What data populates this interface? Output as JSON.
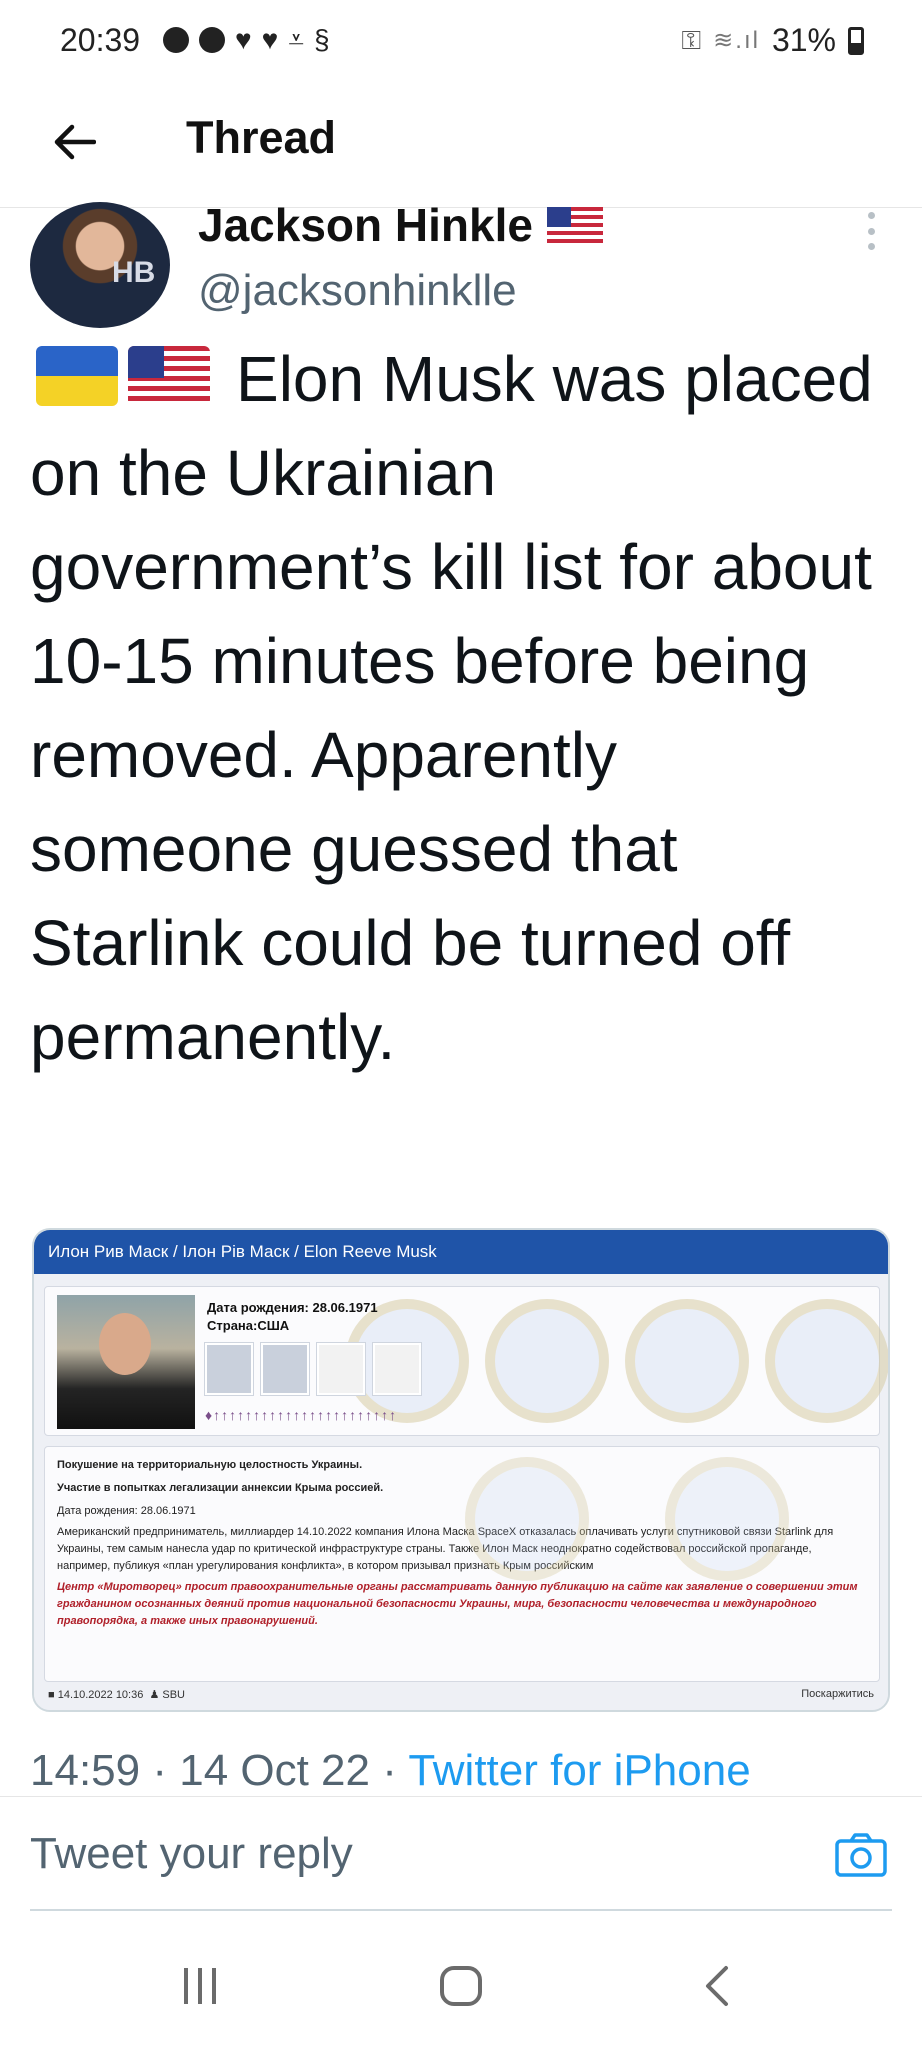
{
  "status_bar": {
    "time": "20:39",
    "battery": "31%",
    "notification_icons": [
      "circle-icon",
      "circle-icon",
      "heart-icon",
      "heart-icon",
      "download-done-icon",
      "shazam-icon"
    ]
  },
  "header": {
    "title": "Thread"
  },
  "tweet": {
    "author_name": "Jackson Hinkle",
    "author_handle": "@jacksonhinklle",
    "avatar_text": "HB",
    "text": "Elon Musk was placed on the Ukrainian government’s kill list for about 10-15 minutes before being removed. Apparently someone guessed that Starlink could be turned off permanently.",
    "flags": [
      "flag-ukraine",
      "flag-usa"
    ],
    "time": "14:59",
    "date": "14 Oct 22",
    "source": "Twitter for iPhone"
  },
  "media": {
    "header": "Илон Рив Маск / Ілон Рів Маск / Elon Reeve Musk",
    "birth_line": "Дата рождения: 28.06.1971",
    "country_line": "Страна:США",
    "headline_1": "Покушение на территориальную целостность Украины.",
    "headline_2": "Участие в попытках легализации аннексии Крыма россией.",
    "birth_small": "Дата рождения: 28.06.1971",
    "body": "Американский предприниматель, миллиардер 14.10.2022 компания Илона Маска SpaceX отказалась оплачивать услуги спутниковой связи Starlink для Украины, тем самым нанесла удар по критической инфраструктуре страны. Также Илон Маск неоднократно содействовал российской пропаганде, например, публикуя «план урегулирования конфликта», в котором призывал признать Крым российским",
    "notice": "Центр «Миротворец» просит правоохранительные органы рассматривать данную публикацию на сайте как заявление о совершении этим гражданином осознанных деяний против национальной безопасности Украины, мира, безопасности человечества и международного правопорядка, а также иных правонарушений.",
    "footer_date": "14.10.2022 10:36",
    "footer_author": "SBU",
    "footer_action": "Поскаржитись"
  },
  "reply": {
    "placeholder": "Tweet your reply"
  },
  "colors": {
    "link": "#1d9bf0",
    "secondary_text": "#536471",
    "media_header": "#1f54a8"
  }
}
